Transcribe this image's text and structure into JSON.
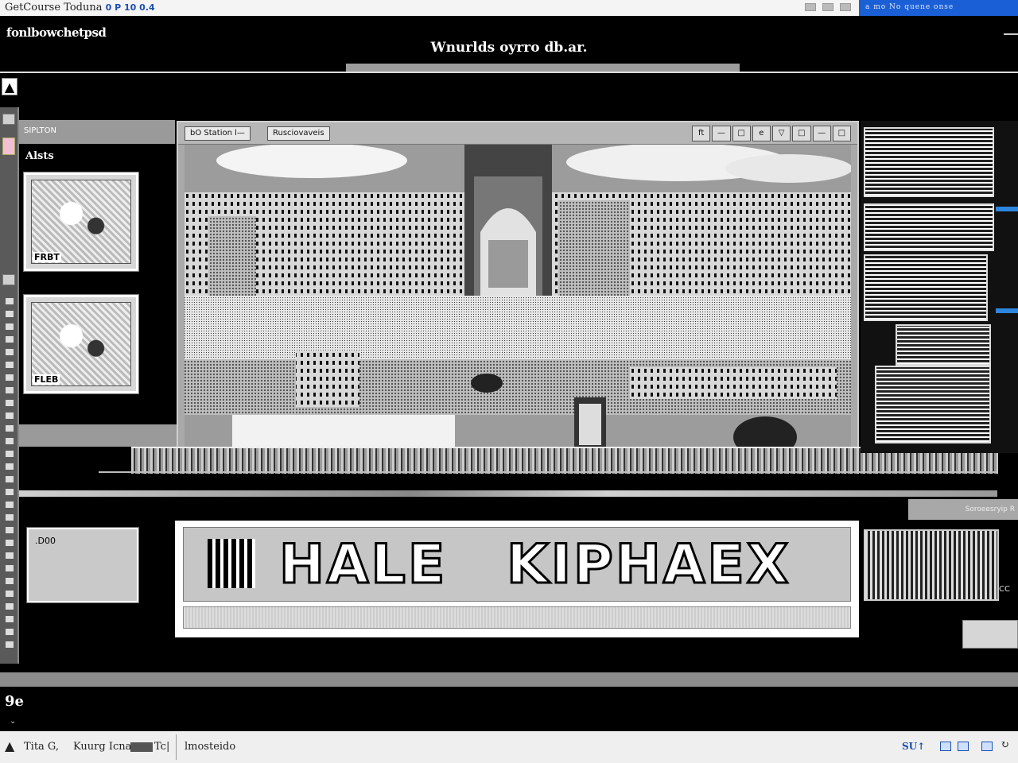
{
  "os_bar": {
    "title": "GetCourse Toduna",
    "title_blue": "0 P 10 0.4",
    "blue_panel_text": "a  mo  No  quene  onse"
  },
  "app": {
    "name": "fonlbowchetpsd",
    "document_title": "Wnurlds oyrro db.ar."
  },
  "sidebar": {
    "header": "SIPLTON",
    "subheader": "Alsts",
    "thumbnails": [
      {
        "label": "FRBT"
      },
      {
        "label": "FLEB"
      }
    ],
    "small_panel_text": ".D00"
  },
  "viewer": {
    "toolbar_left": "bO Station",
    "toolbar_left_suffix": "l—",
    "toolbar_right_button": "Rusciovaveis",
    "toolbar_icons": [
      "ft",
      "—",
      "□",
      "e",
      "▽",
      "□",
      "—",
      "□"
    ]
  },
  "banner": {
    "word_1": "HALE",
    "word_2": "KIPHAEX"
  },
  "gallery": {
    "caption": "Soroeesryip R",
    "lower_label": "CC"
  },
  "bottom": {
    "logo": "9e",
    "tick": "⌄"
  },
  "status_bar": {
    "items": [
      "Tita G,",
      "Kuurg Icna",
      "Tc|",
      "lmosteido"
    ],
    "right_text": "SU↑"
  },
  "colors": {
    "accent_blue": "#1b5fd6",
    "sidebar_pink": "#f3c0d3",
    "gallery_accent": "#2e86de"
  },
  "icons": {
    "tool_main": "image-icon",
    "status_left": "triangle-logo-icon"
  }
}
